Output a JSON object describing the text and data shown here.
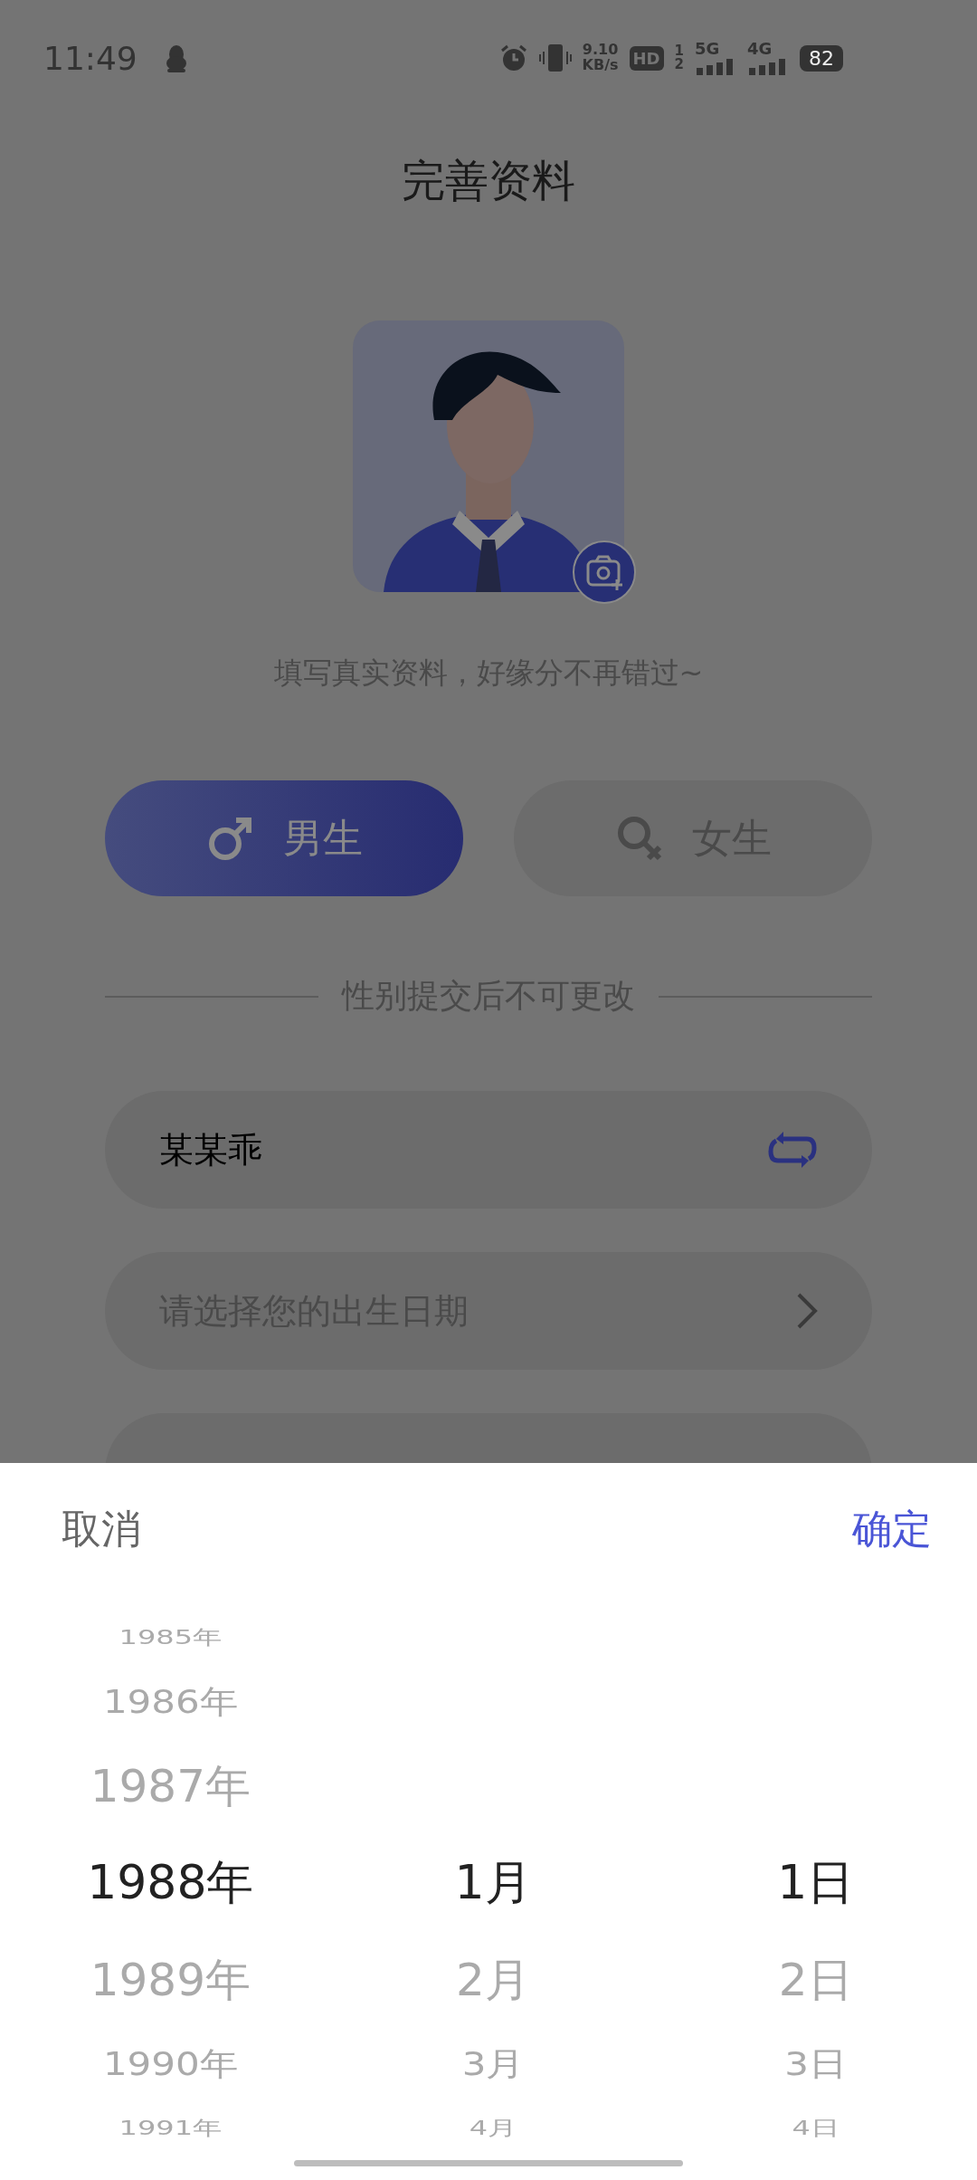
{
  "status_bar": {
    "time": "11:49",
    "speed_value": "9.10",
    "speed_unit": "KB/s",
    "hd": "HD",
    "sim_numbers": [
      "1",
      "2"
    ],
    "networks": [
      "5G",
      "4G"
    ],
    "battery": "82"
  },
  "title": "完善资料",
  "hint": "填写真实资料，好缘分不再错过~",
  "gender_options": [
    {
      "kind": "male",
      "label": "男生",
      "selected": true
    },
    {
      "kind": "female",
      "label": "女生",
      "selected": false
    }
  ],
  "gender_note": "性别提交后不可更改",
  "name_field": {
    "value": "某某乖"
  },
  "birthday_field": {
    "placeholder": "请选择您的出生日期"
  },
  "picker": {
    "cancel": "取消",
    "confirm": "确定",
    "columns": [
      {
        "items": [
          {
            "label": "1985年",
            "selected": false
          },
          {
            "label": "1986年",
            "selected": false
          },
          {
            "label": "1987年",
            "selected": false
          },
          {
            "label": "1988年",
            "selected": true
          },
          {
            "label": "1989年",
            "selected": false
          },
          {
            "label": "1990年",
            "selected": false
          },
          {
            "label": "1991年",
            "selected": false
          }
        ]
      },
      {
        "items": [
          {
            "label": "1月",
            "selected": true
          },
          {
            "label": "2月",
            "selected": false
          },
          {
            "label": "3月",
            "selected": false
          },
          {
            "label": "4月",
            "selected": false
          }
        ]
      },
      {
        "items": [
          {
            "label": "1日",
            "selected": true
          },
          {
            "label": "2日",
            "selected": false
          },
          {
            "label": "3日",
            "selected": false
          },
          {
            "label": "4日",
            "selected": false
          }
        ]
      }
    ]
  }
}
